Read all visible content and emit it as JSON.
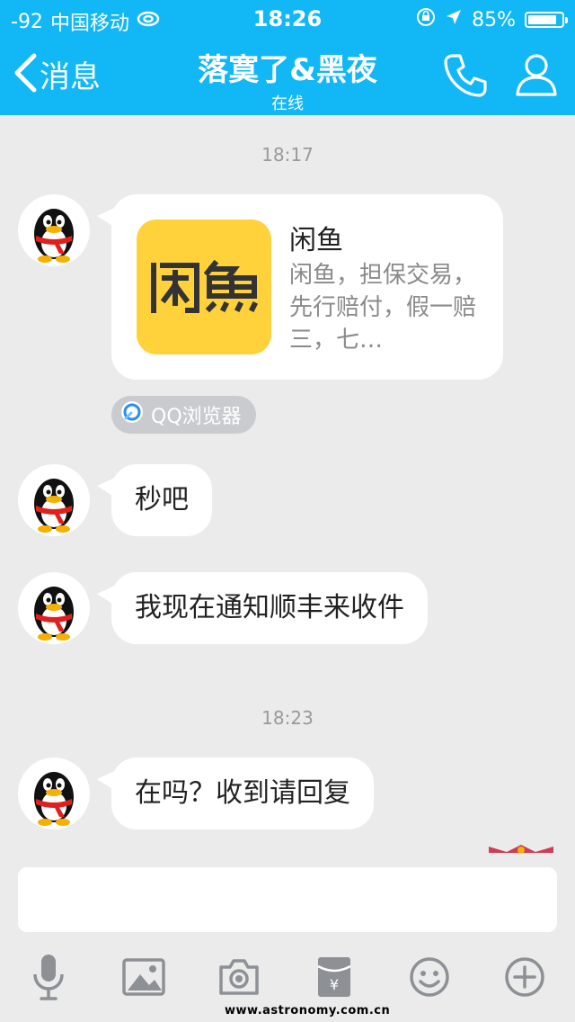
{
  "status_bar": {
    "signal": "-92",
    "carrier": "中国移动",
    "time": "18:26",
    "battery_percent": "85%",
    "battery_level": 0.85
  },
  "nav": {
    "back_label": "消息",
    "title": "落寞了&黑夜",
    "subtitle": "在线"
  },
  "messages": {
    "timestamp_1": "18:17",
    "card": {
      "title": "闲鱼",
      "description": "闲鱼，担保交易，先行赔付，假一赔三，七…",
      "source": "QQ浏览器"
    },
    "msg_1": "秒吧",
    "msg_2": "我现在通知顺丰来收件",
    "timestamp_2": "18:23",
    "msg_3": "在吗？收到请回复"
  },
  "input": {
    "placeholder": ""
  },
  "toolbar": [
    "microphone-icon",
    "image-icon",
    "camera-icon",
    "red-packet-icon",
    "emoji-icon",
    "plus-icon"
  ],
  "watermark": "www.astronomy.com.cn",
  "colors": {
    "nav_bg": "#12b7f5",
    "chat_bg": "#ebebeb",
    "logo_bg": "#ffd23c",
    "icon_gray": "#8d9196"
  }
}
